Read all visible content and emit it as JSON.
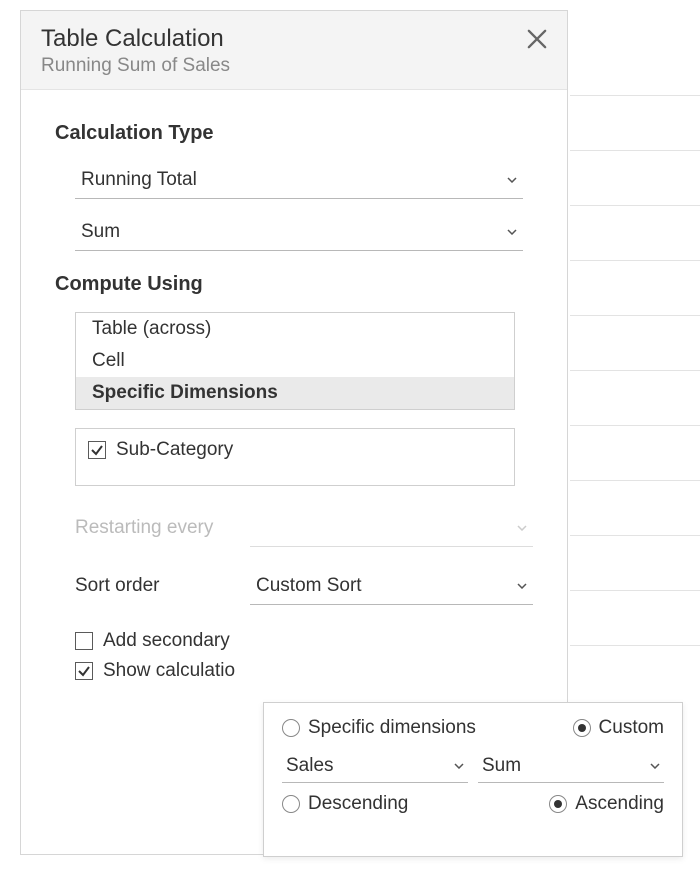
{
  "dialog": {
    "title": "Table Calculation",
    "subtitle": "Running Sum of Sales"
  },
  "calcType": {
    "label": "Calculation Type",
    "func": "Running Total",
    "agg": "Sum"
  },
  "compute": {
    "label": "Compute Using",
    "options": [
      "Table (across)",
      "Cell",
      "Specific Dimensions"
    ],
    "selectedIndex": 2,
    "dimension": "Sub-Category"
  },
  "restart": {
    "label": "Restarting every",
    "value": ""
  },
  "sort": {
    "label": "Sort order",
    "value": "Custom Sort"
  },
  "footer": {
    "addSecondary": "Add secondary",
    "showCalc": "Show calculatio"
  },
  "popup": {
    "r1": {
      "a": "Specific dimensions",
      "b": "Custom"
    },
    "field": "Sales",
    "agg": "Sum",
    "r2": {
      "a": "Descending",
      "b": "Ascending"
    }
  }
}
